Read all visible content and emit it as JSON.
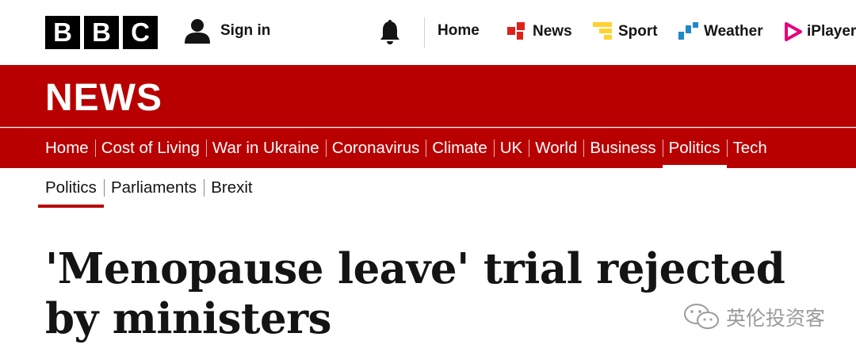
{
  "masthead": {
    "logo_letters": [
      "B",
      "B",
      "C"
    ],
    "sign_in_label": "Sign in",
    "nav": [
      {
        "label": "Home"
      },
      {
        "label": "News"
      },
      {
        "label": "Sport"
      },
      {
        "label": "Weather"
      },
      {
        "label": "iPlayer"
      }
    ]
  },
  "banner": {
    "title": "NEWS"
  },
  "section_nav": {
    "items": [
      "Home",
      "Cost of Living",
      "War in Ukraine",
      "Coronavirus",
      "Climate",
      "UK",
      "World",
      "Business",
      "Politics",
      "Tech"
    ],
    "active": "Politics"
  },
  "sub_nav": {
    "items": [
      "Politics",
      "Parliaments",
      "Brexit"
    ],
    "active": "Politics"
  },
  "article": {
    "headline": "'Menopause leave' trial rejected by ministers"
  },
  "watermark": {
    "text": "英伦投资客"
  },
  "colors": {
    "brand_red": "#b80000",
    "text": "#141414",
    "news_icon": "#e0211a",
    "sport_icon": "#ffd230",
    "weather_icon": "#1e88c8",
    "iplayer_icon": "#e5007e"
  },
  "icons": [
    "user-icon",
    "bell-icon",
    "news-icon",
    "sport-icon",
    "weather-icon",
    "iplayer-icon",
    "wechat-icon"
  ]
}
